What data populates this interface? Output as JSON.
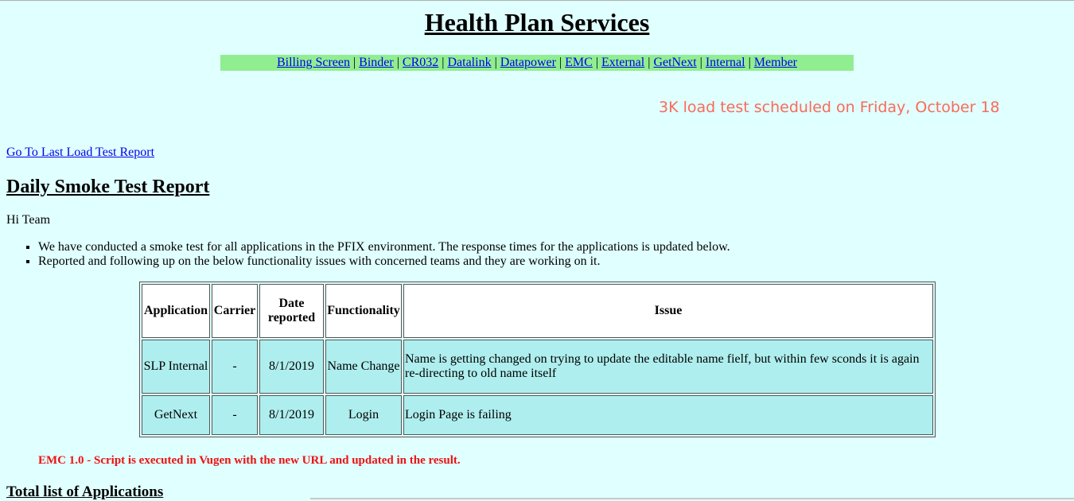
{
  "page_title": "Health Plan Services",
  "nav": {
    "links": [
      "Billing Screen",
      "Binder",
      "CR032",
      "Datalink",
      "Datapower",
      "EMC",
      "External",
      "GetNext",
      "Internal",
      "Member"
    ],
    "separator": "|"
  },
  "announcement": "3K load test scheduled on Friday, October 18",
  "last_report_link": "Go To Last Load Test Report",
  "report_heading": "Daily Smoke Test Report",
  "greeting": "Hi Team",
  "bullets": [
    "We have conducted a smoke test for all applications in the PFIX environment. The response times for the applications is updated below.",
    "Reported and following up on the below functionality issues with concerned teams and they are working on it."
  ],
  "issues_table": {
    "headers": [
      "Application",
      "Carrier",
      "Date reported",
      "Functionality",
      "Issue"
    ],
    "rows": [
      [
        "SLP Internal",
        "-",
        "8/1/2019",
        "Name Change",
        "Name is getting changed on trying to update the editable name fielf, but within few sconds it is again re-directing to old name itself"
      ],
      [
        "GetNext",
        "-",
        "8/1/2019",
        "Login",
        "Login Page is failing"
      ]
    ]
  },
  "emc_note": "EMC 1.0 - Script is executed in Vugen with the new URL and updated in the result.",
  "total_heading": "Total list of Applications",
  "colors": {
    "background": "#e0ffff",
    "nav_bar": "#90ee90",
    "table_cell": "#afeeee",
    "announcement": "#fa6a5a",
    "emc_note": "#ee1111",
    "link": "#0000ee"
  }
}
